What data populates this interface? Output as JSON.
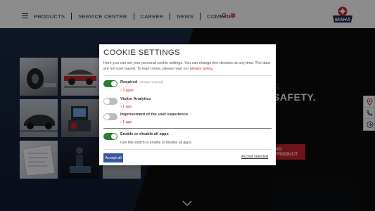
{
  "header": {
    "nav": [
      "PRODUCTS",
      "SERVICE CENTER",
      "CAREER",
      "NEWS",
      "COMPANY"
    ],
    "logo_text": "MAHA",
    "icons": [
      "menu-icon",
      "search-icon",
      "globe-icon"
    ]
  },
  "hero": {
    "headline_partial": "S",
    "headline": "SAFETY.",
    "button_partial": "ND PRODUCT"
  },
  "side_tools": [
    "location-pin-icon",
    "phone-icon",
    "login-icon"
  ],
  "cookie": {
    "title": "COOKIE SETTINGS",
    "description": "Here you can set your personal cookie settings. You can change this decision at any time. The data are not user based. To learn more, please read our",
    "privacy_link": "privacy policy",
    "options": [
      {
        "label": "Required",
        "note": "(always required)",
        "apps": "3 apps",
        "enabled": true
      },
      {
        "label": "Visitor Analytics",
        "apps": "1 app",
        "enabled": false
      },
      {
        "label": "Improvement of the user experience",
        "apps": "1 app",
        "enabled": false
      }
    ],
    "master": {
      "label": "Enable or disable all apps",
      "description": "Use this switch to enable or disable all apps.",
      "enabled": true
    },
    "accept_all": "Accept all",
    "accept_selected": "Accept selected"
  },
  "colors": {
    "brand_red": "#c8232c",
    "navy": "#1d2a4d",
    "toggle_on": "#2e7d32",
    "button_blue": "#3855a0"
  }
}
